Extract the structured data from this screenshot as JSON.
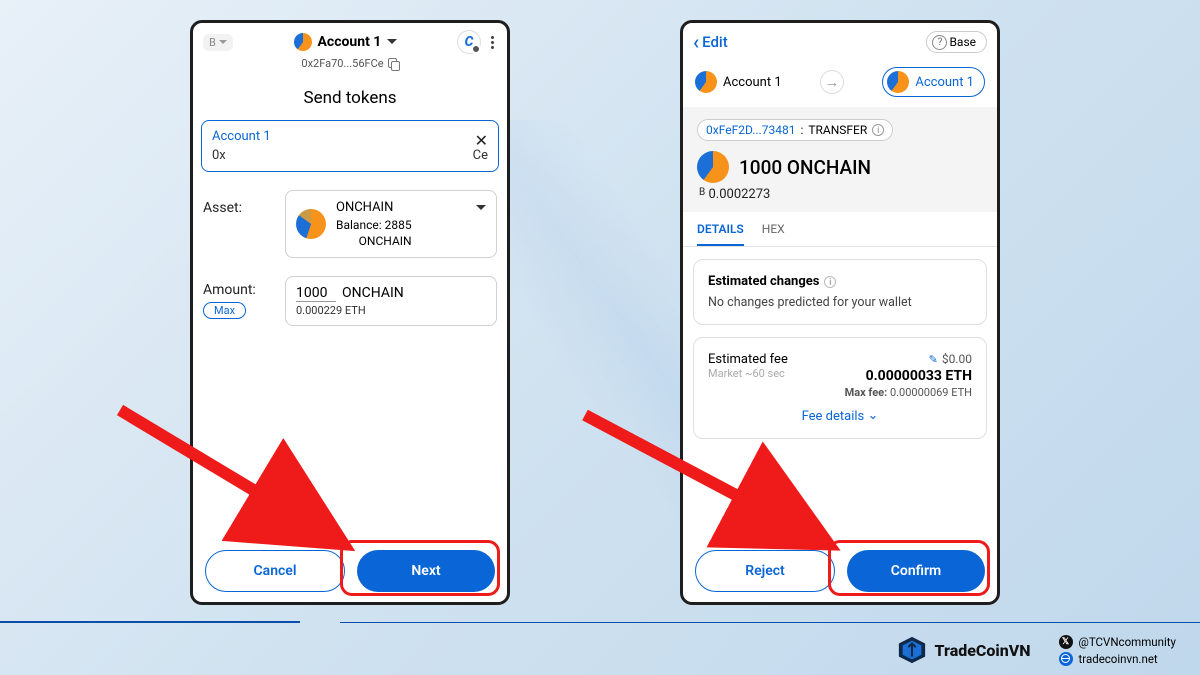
{
  "left": {
    "network_short": "B",
    "account_name": "Account 1",
    "address": "0x2Fa70...56FCe",
    "title": "Send tokens",
    "dest_label": "Account 1",
    "dest_prefix": "0x",
    "dest_suffix": "Ce",
    "asset_label": "Asset:",
    "asset_name": "ONCHAIN",
    "balance_label": "Balance:",
    "balance": "2885",
    "balance_unit": "ONCHAIN",
    "amount_label": "Amount:",
    "max_label": "Max",
    "amount_value": "1000",
    "amount_unit": "ONCHAIN",
    "amount_sub": "0.000229 ETH",
    "cancel": "Cancel",
    "next": "Next"
  },
  "right": {
    "edit": "Edit",
    "base": "Base",
    "from_account": "Account 1",
    "to_account": "Account 1",
    "contract_addr": "0xFeF2D...73481",
    "contract_sep": " : ",
    "contract_action": "TRANSFER",
    "amount": "1000 ONCHAIN",
    "amount_sub_prefix": "B",
    "amount_sub": "0.0002273",
    "tab_details": "DETAILS",
    "tab_hex": "HEX",
    "est_changes_title": "Estimated changes",
    "est_changes_text": "No changes predicted for your wallet",
    "est_fee_label": "Estimated fee",
    "market_label": "Market",
    "market_time": "~60 sec",
    "fee_usd": "$0.00",
    "fee_eth": "0.00000033 ETH",
    "fee_max_label": "Max fee:",
    "fee_max": "0.00000069 ETH",
    "fee_details": "Fee details",
    "reject": "Reject",
    "confirm": "Confirm"
  },
  "footer": {
    "brand": "TradeCoinVN",
    "twitter": "@TCVNcommunity",
    "site": "tradecoinvn.net"
  }
}
